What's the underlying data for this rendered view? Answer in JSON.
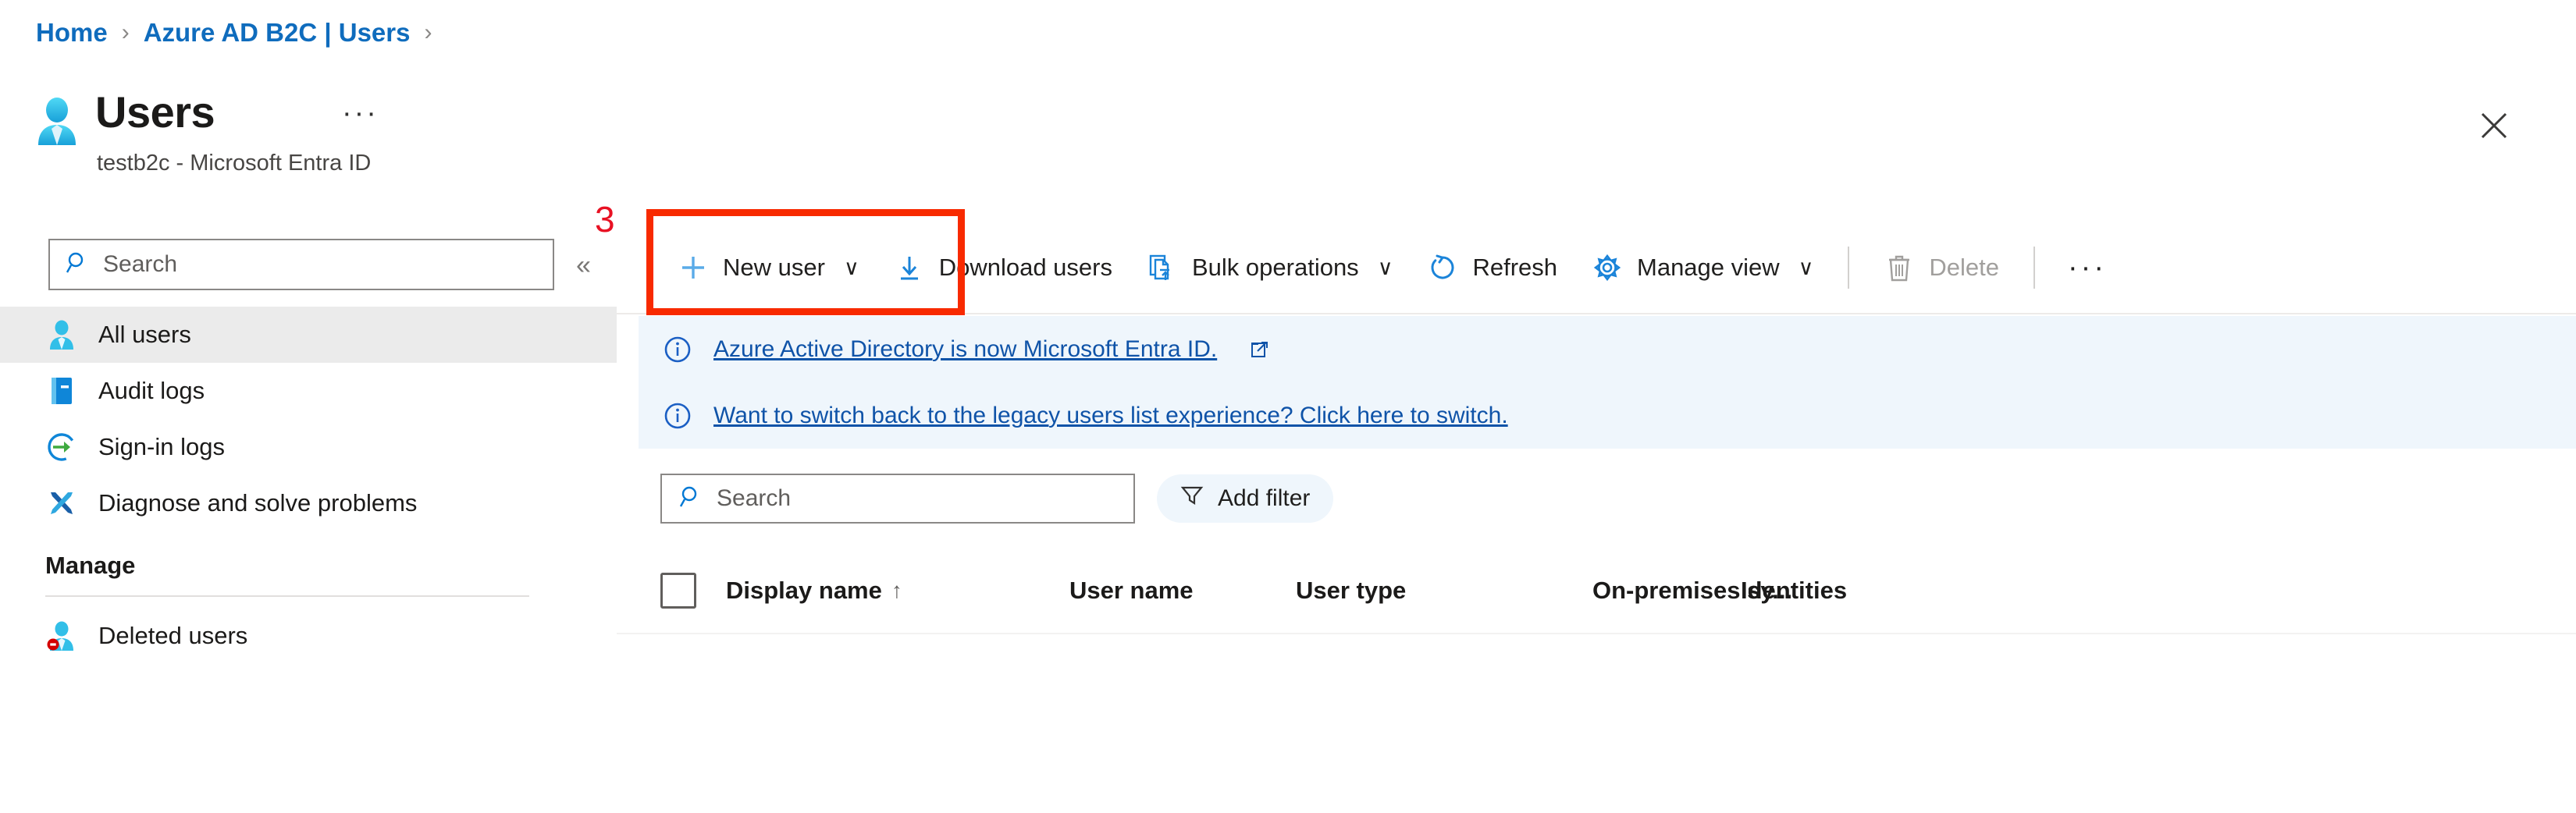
{
  "breadcrumb": [
    {
      "label": "Home",
      "icon": ""
    },
    {
      "label": "Azure AD B2C | Users",
      "icon": ""
    }
  ],
  "header": {
    "title": "Users",
    "subtitle": "testb2c - Microsoft Entra ID",
    "icon": "user-icon",
    "ellipsis": "···",
    "close_icon": "close-icon"
  },
  "sidebar": {
    "search": {
      "placeholder": "Search",
      "value": "",
      "icon": "search-icon"
    },
    "collapse_icon": "«",
    "items": [
      {
        "label": "All users",
        "icon": "user-icon",
        "selected": true
      },
      {
        "label": "Audit logs",
        "icon": "book-icon",
        "selected": false
      },
      {
        "label": "Sign-in logs",
        "icon": "signin-icon",
        "selected": false
      },
      {
        "label": "Diagnose and solve problems",
        "icon": "wrench-icon",
        "selected": false
      }
    ],
    "group_title": "Manage",
    "group_items": [
      {
        "label": "Deleted users",
        "icon": "deleted-user-icon",
        "selected": false
      }
    ]
  },
  "toolbar": {
    "new_user": {
      "label": "New user",
      "icon": "plus-icon",
      "caret": "∨"
    },
    "download_users": {
      "label": "Download users",
      "icon": "download-icon"
    },
    "bulk_operations": {
      "label": "Bulk operations",
      "icon": "bulk-icon",
      "caret": "∨"
    },
    "refresh": {
      "label": "Refresh",
      "icon": "refresh-icon"
    },
    "manage_view": {
      "label": "Manage view",
      "icon": "gear-icon",
      "caret": "∨"
    },
    "delete": {
      "label": "Delete",
      "icon": "trash-icon",
      "disabled": true
    },
    "overflow": "···"
  },
  "banners": [
    {
      "text": "Azure Active Directory is now Microsoft Entra ID.",
      "icon": "info-icon",
      "external_link_icon": "external-link-icon"
    },
    {
      "text": "Want to switch back to the legacy users list experience? Click here to switch.",
      "icon": "info-icon",
      "external_link_icon": ""
    }
  ],
  "filters": {
    "search": {
      "placeholder": "Search",
      "value": "",
      "icon": "search-icon"
    },
    "add_filter": {
      "label": "Add filter",
      "icon": "filter-icon"
    }
  },
  "table": {
    "select_all": "",
    "columns": [
      {
        "label": "Display name",
        "sort": "↑"
      },
      {
        "label": "User name",
        "sort": ""
      },
      {
        "label": "User type",
        "sort": ""
      },
      {
        "label": "On-premises sy...",
        "sort": ""
      },
      {
        "label": "Identities",
        "sort": ""
      }
    ],
    "rows": []
  },
  "annotation": {
    "number": "3",
    "target": "new-user-button"
  },
  "colors": {
    "link": "#0f6cbd",
    "banner_bg": "#eff6fc",
    "banner_link": "#0f53a8",
    "selected_bg": "#ebebeb",
    "annotation": "#f82a00",
    "accent": "#0078d4"
  }
}
